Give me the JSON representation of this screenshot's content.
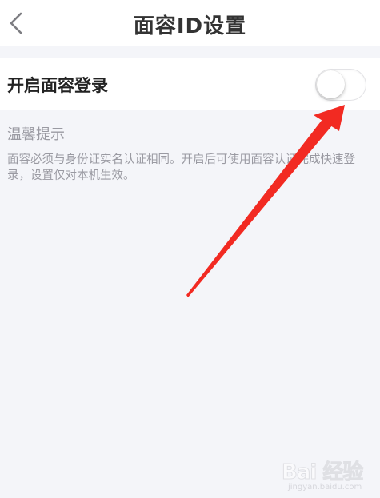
{
  "header": {
    "back_icon": "chevron-left-icon",
    "title": "面容ID设置"
  },
  "setting": {
    "label": "开启面容登录",
    "toggle_state": "off"
  },
  "tips": {
    "title": "温馨提示",
    "text": "面容必须与身份证实名认证相同。开启后可使用面容认证完成快速登录，设置仅对本机生效。"
  },
  "annotation": {
    "type": "red-arrow-pointing-at-toggle",
    "color": "#f22a22"
  },
  "watermark": {
    "text": "Bai 经验",
    "subtext": "jingyan.baidu.com"
  }
}
